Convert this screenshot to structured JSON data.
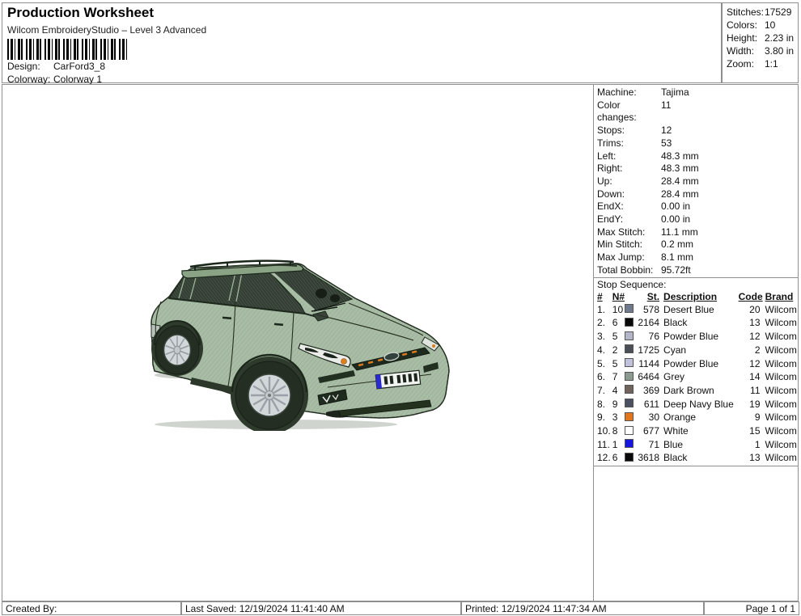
{
  "header": {
    "title": "Production Worksheet",
    "subtitle": "Wilcom EmbroideryStudio – Level 3 Advanced",
    "design_label": "Design:",
    "design_value": "CarFord3_8",
    "colorway_label": "Colorway:",
    "colorway_value": "Colorway 1"
  },
  "summary": {
    "rows": [
      {
        "label": "Stitches:",
        "value": "17529"
      },
      {
        "label": "Colors:",
        "value": "10"
      },
      {
        "label": "Height:",
        "value": "2.23 in"
      },
      {
        "label": "Width:",
        "value": "3.80 in"
      },
      {
        "label": "Zoom:",
        "value": "1:1"
      }
    ]
  },
  "machine_info": {
    "rows": [
      {
        "label": "Machine:",
        "value": "Tajima"
      },
      {
        "label": "Color changes:",
        "value": "11"
      },
      {
        "label": "Stops:",
        "value": "12"
      },
      {
        "label": "Trims:",
        "value": "53"
      },
      {
        "label": "Left:",
        "value": "48.3 mm"
      },
      {
        "label": "Right:",
        "value": "48.3 mm"
      },
      {
        "label": "Up:",
        "value": "28.4 mm"
      },
      {
        "label": "Down:",
        "value": "28.4 mm"
      },
      {
        "label": "EndX:",
        "value": "0.00 in"
      },
      {
        "label": "EndY:",
        "value": "0.00 in"
      },
      {
        "label": "Max Stitch:",
        "value": "11.1 mm"
      },
      {
        "label": "Min Stitch:",
        "value": "0.2 mm"
      },
      {
        "label": "Max Jump:",
        "value": "8.1 mm"
      },
      {
        "label": "Total Bobbin:",
        "value": "95.72ft"
      }
    ]
  },
  "stop_sequence": {
    "title": "Stop Sequence:",
    "columns": {
      "hash": "#",
      "needle": "N#",
      "stitches": "St.",
      "description": "Description",
      "code": "Code",
      "brand": "Brand"
    },
    "rows": [
      {
        "num": "1.",
        "n": "10",
        "color": "#6f7b8c",
        "st": "578",
        "description": "Desert Blue",
        "code": "20",
        "brand": "Wilcom"
      },
      {
        "num": "2.",
        "n": "6",
        "color": "#0a0a0a",
        "st": "2164",
        "description": "Black",
        "code": "13",
        "brand": "Wilcom"
      },
      {
        "num": "3.",
        "n": "5",
        "color": "#b3b6c9",
        "st": "76",
        "description": "Powder Blue",
        "code": "12",
        "brand": "Wilcom"
      },
      {
        "num": "4.",
        "n": "2",
        "color": "#4a4e55",
        "st": "1725",
        "description": "Cyan",
        "code": "2",
        "brand": "Wilcom"
      },
      {
        "num": "5.",
        "n": "5",
        "color": "#c0c1da",
        "st": "1144",
        "description": "Powder Blue",
        "code": "12",
        "brand": "Wilcom"
      },
      {
        "num": "6.",
        "n": "7",
        "color": "#8b9a8e",
        "st": "6464",
        "description": "Grey",
        "code": "14",
        "brand": "Wilcom"
      },
      {
        "num": "7.",
        "n": "4",
        "color": "#6f635c",
        "st": "369",
        "description": "Dark Brown",
        "code": "11",
        "brand": "Wilcom"
      },
      {
        "num": "8.",
        "n": "9",
        "color": "#4b5161",
        "st": "611",
        "description": "Deep Navy Blue",
        "code": "19",
        "brand": "Wilcom"
      },
      {
        "num": "9.",
        "n": "3",
        "color": "#e1761c",
        "st": "30",
        "description": "Orange",
        "code": "9",
        "brand": "Wilcom"
      },
      {
        "num": "10.",
        "n": "8",
        "color": "#fdfdfd",
        "st": "677",
        "description": "White",
        "code": "15",
        "brand": "Wilcom"
      },
      {
        "num": "11.",
        "n": "1",
        "color": "#1616e0",
        "st": "71",
        "description": "Blue",
        "code": "1",
        "brand": "Wilcom"
      },
      {
        "num": "12.",
        "n": "6",
        "color": "#0a0a0a",
        "st": "3618",
        "description": "Black",
        "code": "13",
        "brand": "Wilcom"
      }
    ]
  },
  "footer": {
    "created_by": "Created By:",
    "last_saved": "Last Saved: 12/19/2024 11:41:40 AM",
    "printed": "Printed: 12/19/2024 11:47:34 AM",
    "page": "Page 1 of 1"
  },
  "design_preview": {
    "subject": "Green Ford station wagon embroidery design, three-quarter front-left view",
    "colors": {
      "body": "#a9bda6",
      "body_shade": "#7f977b",
      "roof": "#8aa385",
      "glass": "#343e34",
      "outline": "#1e291d",
      "wheel_rim": "#d2d7da",
      "tire": "#242e22",
      "accent_orange": "#dd7f1f",
      "plate_blue": "#2a2ad2",
      "headlight": "#e9ece8"
    }
  }
}
